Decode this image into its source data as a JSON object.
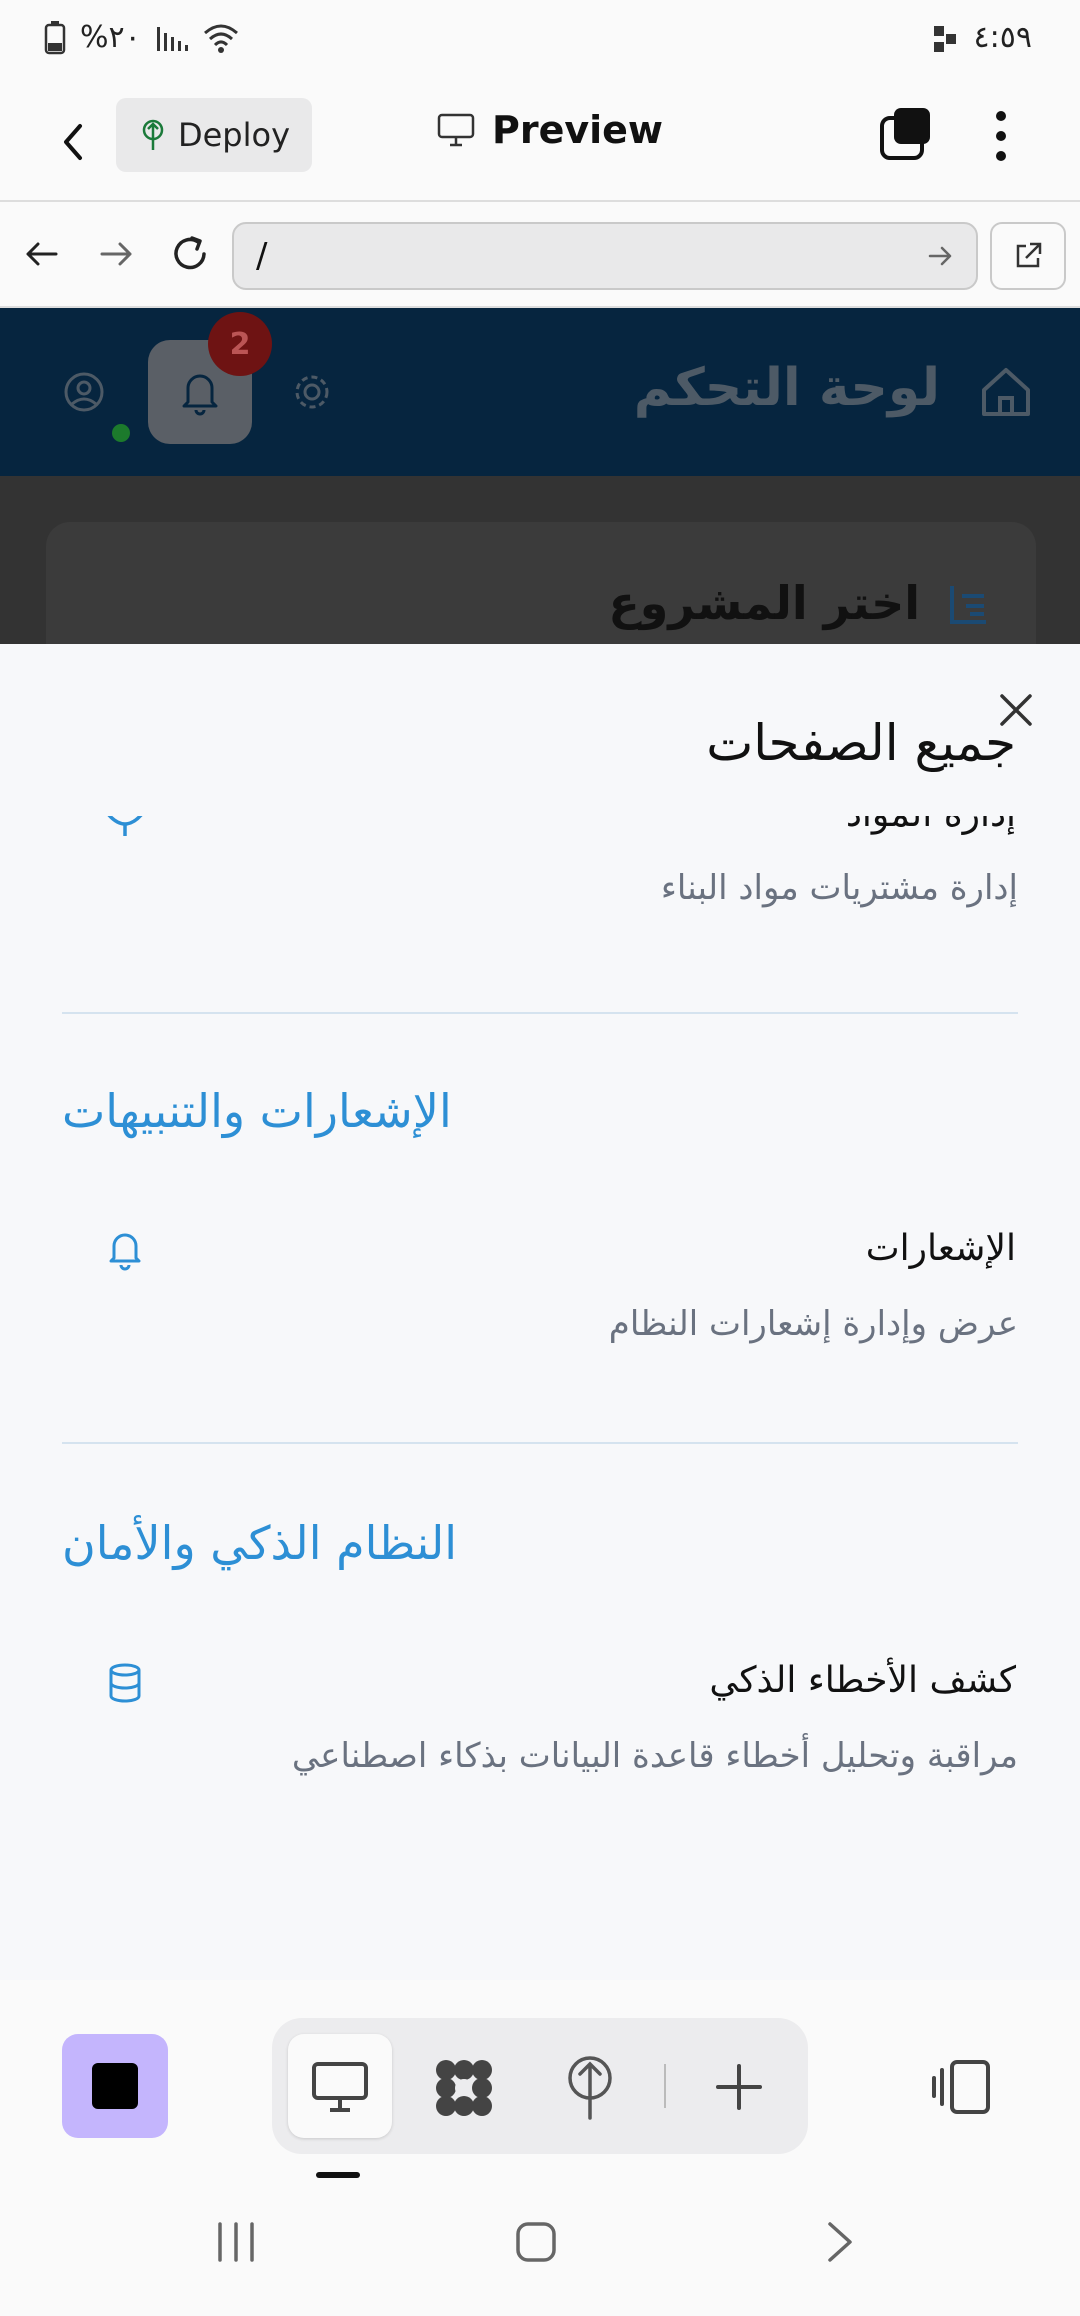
{
  "status_bar": {
    "time": "٤:٥٩",
    "battery": "%٢٠"
  },
  "app_header": {
    "deploy_label": "Deploy",
    "preview_label": "Preview"
  },
  "url_bar": {
    "value": "/"
  },
  "underlying_page": {
    "dashboard_title": "لوحة التحكم",
    "notification_count": "2",
    "card_title": "اختر المشروع"
  },
  "sheet": {
    "title": "جميع الصفحات",
    "partial_item": {
      "title": "إدارة المواد",
      "description": "إدارة مشتريات مواد البناء"
    },
    "sections": [
      {
        "heading": "الإشعارات والتنبيهات",
        "items": [
          {
            "title": "الإشعارات",
            "description": "عرض وإدارة إشعارات النظام",
            "icon": "bell-icon"
          }
        ]
      },
      {
        "heading": "النظام الذكي والأمان",
        "items": [
          {
            "title": "كشف الأخطاء الذكي",
            "description": "مراقبة وتحليل أخطاء قاعدة البيانات بذكاء اصطناعي",
            "icon": "database-icon"
          }
        ]
      }
    ]
  },
  "colors": {
    "accent": "#2d8fd5",
    "stop_button": "#c4b5fd",
    "dashboard_header": "#06253f"
  }
}
